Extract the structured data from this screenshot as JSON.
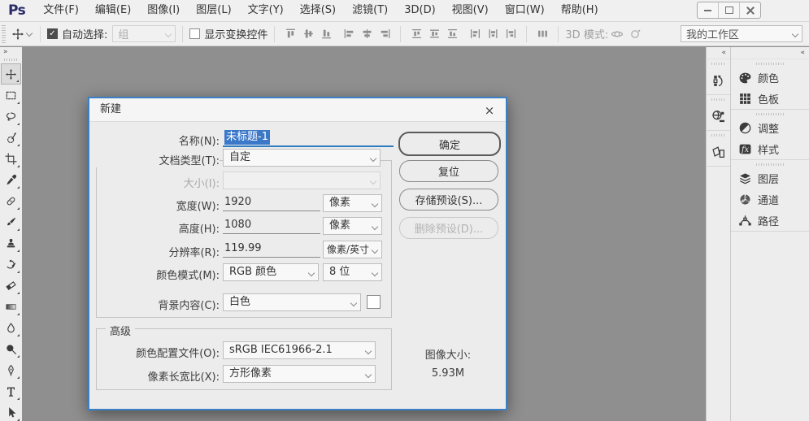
{
  "icons": {
    "close": "×",
    "toolbar_expand": "»",
    "dock_collapse": "«"
  },
  "colors": {
    "accent_blue": "#3b80c4",
    "selection_blue": "#3c78c8",
    "canvas_gray": "#8f8f8f",
    "chrome_bg": "#f0f0f0",
    "dialog_bg": "#ececec",
    "logo_navy": "#2b2b6b"
  },
  "menu_bar": {
    "logo": "Ps",
    "items": [
      "文件(F)",
      "编辑(E)",
      "图像(I)",
      "图层(L)",
      "文字(Y)",
      "选择(S)",
      "滤镜(T)",
      "3D(D)",
      "视图(V)",
      "窗口(W)",
      "帮助(H)"
    ]
  },
  "options_bar": {
    "auto_select": {
      "label": "自动选择:",
      "checked": true,
      "value": "组"
    },
    "show_transform": {
      "label": "显示变换控件",
      "checked": false
    },
    "mode_3d_label": "3D 模式:",
    "workspace": "我的工作区"
  },
  "toolbar": {
    "selected_tool": "move",
    "tools": [
      "move",
      "rectangular-marquee",
      "lasso",
      "quick-selection",
      "crop",
      "eyedropper",
      "spot-healing",
      "brush",
      "clone-stamp",
      "history-brush",
      "eraser",
      "gradient",
      "blur",
      "dodge",
      "pen",
      "type",
      "path-selection"
    ]
  },
  "dock": {
    "narrow_icons": [
      "history",
      "3d",
      "pages"
    ],
    "groups": [
      {
        "items": [
          {
            "icon": "palette",
            "label": "颜色"
          },
          {
            "icon": "swatches",
            "label": "色板"
          }
        ]
      },
      {
        "items": [
          {
            "icon": "adjustments",
            "label": "调整"
          },
          {
            "icon": "fx",
            "label": "样式"
          }
        ]
      },
      {
        "items": [
          {
            "icon": "layers",
            "label": "图层"
          },
          {
            "icon": "channels",
            "label": "通道"
          },
          {
            "icon": "paths",
            "label": "路径"
          }
        ]
      }
    ]
  },
  "dialog": {
    "title": "新建",
    "name": {
      "label": "名称(N):",
      "value": "未标题-1"
    },
    "doc_type": {
      "label": "文档类型(T):",
      "value": "自定"
    },
    "size": {
      "label": "大小(I):",
      "value": ""
    },
    "width": {
      "label": "宽度(W):",
      "value": "1920",
      "unit": "像素"
    },
    "height": {
      "label": "高度(H):",
      "value": "1080",
      "unit": "像素"
    },
    "resolution": {
      "label": "分辨率(R):",
      "value": "119.99",
      "unit": "像素/英寸"
    },
    "color_mode": {
      "label": "颜色模式(M):",
      "value": "RGB 颜色",
      "depth": "8 位"
    },
    "background": {
      "label": "背景内容(C):",
      "value": "白色"
    },
    "advanced": {
      "label": "高级",
      "profile": {
        "label": "颜色配置文件(O):",
        "value": "sRGB IEC61966-2.1"
      },
      "aspect": {
        "label": "像素长宽比(X):",
        "value": "方形像素"
      }
    },
    "buttons": {
      "ok": "确定",
      "reset": "复位",
      "save_preset": "存储预设(S)...",
      "delete_preset": "删除预设(D)..."
    },
    "image_size": {
      "label": "图像大小:",
      "value": "5.93M"
    }
  }
}
